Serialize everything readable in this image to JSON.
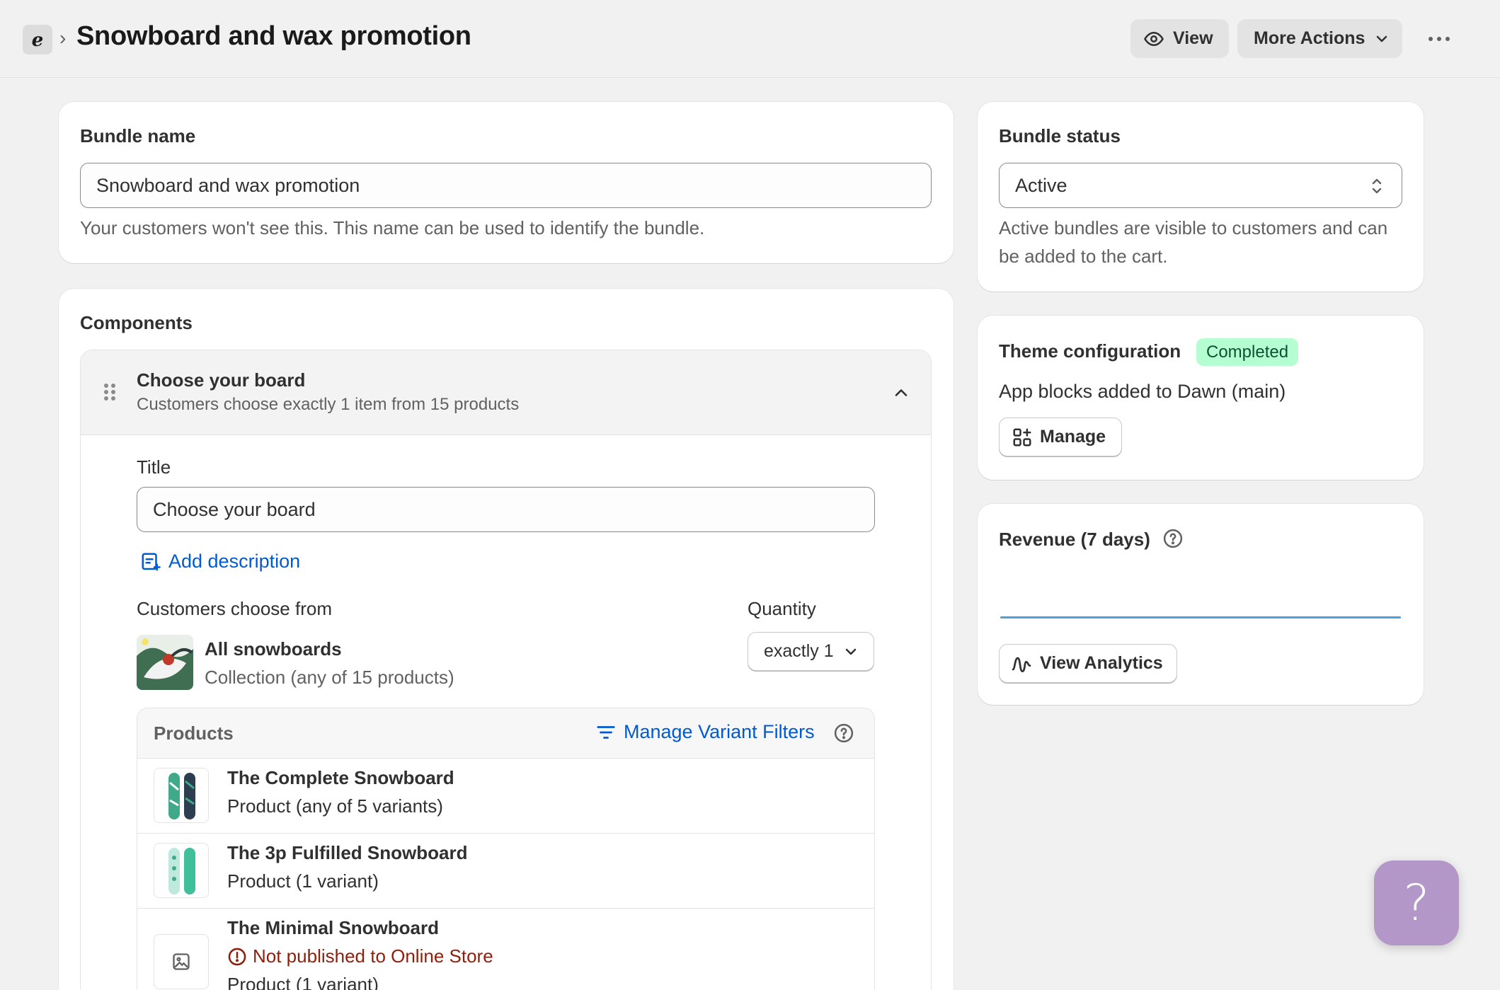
{
  "header": {
    "app_logo": "ℯ",
    "breadcrumb_separator": "›",
    "title": "Snowboard and wax promotion",
    "view_label": "View",
    "more_actions_label": "More Actions"
  },
  "bundle_name": {
    "heading": "Bundle name",
    "value": "Snowboard and wax promotion",
    "help": "Your customers won't see this. This name can be used to identify the bundle."
  },
  "components": {
    "heading": "Components",
    "group": {
      "title": "Choose your board",
      "subtitle": "Customers choose exactly 1 item from 15 products",
      "title_label": "Title",
      "title_value": "Choose your board",
      "add_description": "Add description",
      "choose_from_label": "Customers choose from",
      "quantity_label": "Quantity",
      "collection_name": "All snowboards",
      "collection_sub": "Collection (any of 15 products)",
      "quantity_value": "exactly 1"
    },
    "products": {
      "heading": "Products",
      "manage_filters": "Manage Variant Filters",
      "items": [
        {
          "name": "The Complete Snowboard",
          "sub": "Product (any of 5 variants)"
        },
        {
          "name": "The 3p Fulfilled Snowboard",
          "sub": "Product (1 variant)"
        },
        {
          "name": "The Minimal Snowboard",
          "warning": "Not published to Online Store",
          "sub": "Product (1 variant)"
        }
      ]
    }
  },
  "bundle_status": {
    "heading": "Bundle status",
    "selected": "Active",
    "help": "Active bundles are visible to customers and can be added to the cart."
  },
  "theme_config": {
    "heading": "Theme configuration",
    "badge": "Completed",
    "text": "App blocks added to Dawn (main)",
    "manage_label": "Manage"
  },
  "revenue": {
    "heading": "Revenue (7 days)",
    "view_analytics_label": "View Analytics"
  },
  "help_fab": "?",
  "colors": {
    "link": "#005bd3",
    "badge_bg": "#b4fed2",
    "badge_text": "#0c5132",
    "warning": "#8e1f0b",
    "fab": "#b497c9",
    "chart_line": "#4a9fe0"
  }
}
